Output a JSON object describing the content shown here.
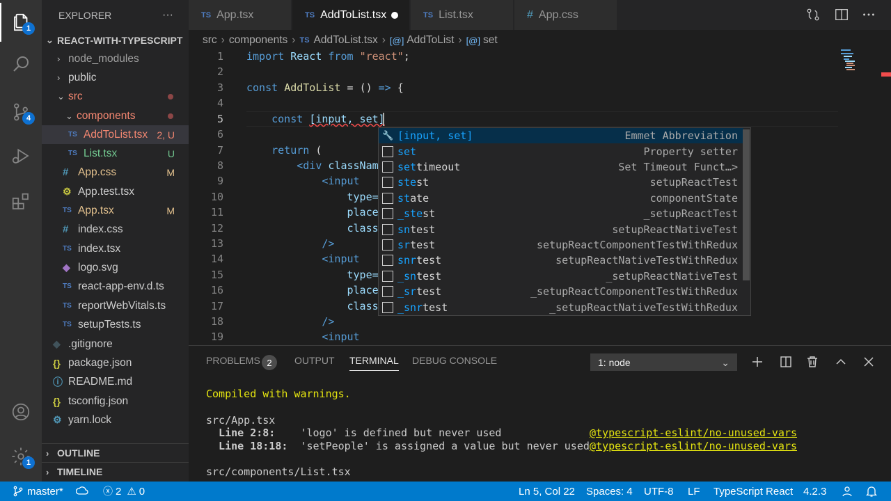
{
  "activity_bar": {
    "explorer_badge": "1",
    "scm_badge": "4",
    "settings_badge": "1"
  },
  "sidebar": {
    "title": "EXPLORER",
    "more": "···",
    "project": "REACT-WITH-TYPESCRIPT",
    "items": [
      {
        "label": "node_modules",
        "status": ""
      },
      {
        "label": "public",
        "status": ""
      },
      {
        "label": "src",
        "status": ""
      },
      {
        "label": "components",
        "status": ""
      },
      {
        "label": "AddToList.tsx",
        "status": "2, U"
      },
      {
        "label": "List.tsx",
        "status": "U"
      },
      {
        "label": "App.css",
        "status": "M"
      },
      {
        "label": "App.test.tsx",
        "status": ""
      },
      {
        "label": "App.tsx",
        "status": "M"
      },
      {
        "label": "index.css",
        "status": ""
      },
      {
        "label": "index.tsx",
        "status": ""
      },
      {
        "label": "logo.svg",
        "status": ""
      },
      {
        "label": "react-app-env.d.ts",
        "status": ""
      },
      {
        "label": "reportWebVitals.ts",
        "status": ""
      },
      {
        "label": "setupTests.ts",
        "status": ""
      },
      {
        "label": ".gitignore",
        "status": ""
      },
      {
        "label": "package.json",
        "status": ""
      },
      {
        "label": "README.md",
        "status": ""
      },
      {
        "label": "tsconfig.json",
        "status": ""
      },
      {
        "label": "yarn.lock",
        "status": ""
      }
    ],
    "file_badges": {
      "ts": "TS",
      "hash": "#",
      "braces": "{}",
      "info": "ⓘ",
      "gear": "⚙",
      "diamond": "◆"
    },
    "outline": "OUTLINE",
    "timeline": "TIMELINE"
  },
  "tabs": [
    {
      "label": "App.tsx",
      "type": "TS"
    },
    {
      "label": "AddToList.tsx",
      "type": "TS"
    },
    {
      "label": "List.tsx",
      "type": "TS"
    },
    {
      "label": "App.css",
      "type": "#"
    }
  ],
  "breadcrumb": {
    "parts": [
      "src",
      "components",
      "AddToList.tsx",
      "AddToList",
      "set"
    ],
    "ts_badge": "TS",
    "symbol": "[@]"
  },
  "editor": {
    "line_numbers": [
      "1",
      "2",
      "3",
      "4",
      "5",
      "6",
      "7",
      "8",
      "9",
      "10",
      "11",
      "12",
      "13",
      "14",
      "15",
      "16",
      "17",
      "18",
      "19"
    ],
    "l1": {
      "a": "import",
      "b": "React",
      "c": "from",
      "d": "\"react\"",
      "e": ";"
    },
    "l3": {
      "a": "const",
      "b": "AddToList",
      "c": "=",
      "d": "()",
      "e": "=>",
      "f": "{"
    },
    "l5": {
      "a": "const",
      "b": "[input, set]"
    },
    "l7": {
      "a": "return",
      "b": "("
    },
    "l8": {
      "a": "<div",
      "b": "classNam"
    },
    "l9": {
      "a": "<input"
    },
    "l10": {
      "a": "type="
    },
    "l11": {
      "a": "place"
    },
    "l12": {
      "a": "class"
    },
    "l13": {
      "a": "/>"
    },
    "l14": {
      "a": "<input"
    },
    "l15": {
      "a": "type="
    },
    "l16": {
      "a": "place"
    },
    "l17": {
      "a": "class"
    },
    "l18": {
      "a": "/>"
    },
    "l19": {
      "a": "<input"
    }
  },
  "suggestions": [
    {
      "match": "[input, set]",
      "rest": "",
      "detail": "Emmet Abbreviation",
      "selected": true
    },
    {
      "match": "set",
      "rest": "",
      "detail": "Property setter"
    },
    {
      "match": "set",
      "rest": "timeout",
      "detail": "Set Timeout Funct…>"
    },
    {
      "match": "ste",
      "rest": "st",
      "detail": "setupReactTest"
    },
    {
      "match": "st",
      "rest": "ate",
      "detail": "componentState"
    },
    {
      "match": "_ste",
      "rest": "st",
      "detail": "_setupReactTest"
    },
    {
      "match": "sn",
      "rest": "test",
      "detail": "setupReactNativeTest"
    },
    {
      "match": "sr",
      "rest": "test",
      "detail": "setupReactComponentTestWithRedux"
    },
    {
      "match": "snr",
      "rest": "test",
      "detail": "setupReactNativeTestWithRedux"
    },
    {
      "match": "_sn",
      "rest": "test",
      "detail": "_setupReactNativeTest"
    },
    {
      "match": "_sr",
      "rest": "test",
      "detail": "_setupReactComponentTestWithRedux"
    },
    {
      "match": "_snr",
      "rest": "test",
      "detail": "_setupReactNativeTestWithRedux"
    }
  ],
  "panel": {
    "tabs": [
      "PROBLEMS",
      "OUTPUT",
      "TERMINAL",
      "DEBUG CONSOLE"
    ],
    "problems_count": "2",
    "terminal_select": "1: node",
    "lines": {
      "compiled": "Compiled with warnings.",
      "file1": "src/App.tsx",
      "w1_loc": "  Line 2:8:",
      "w1_msg": "    'logo' is defined but never used",
      "w1_rule": "@typescript-eslint/no-unused-vars",
      "w2_loc": "  Line 18:18:",
      "w2_msg": "  'setPeople' is assigned a value but never used",
      "w2_rule": "@typescript-eslint/no-unused-vars",
      "file2": "src/components/List.tsx"
    }
  },
  "status_bar": {
    "branch": "master*",
    "errors": "2",
    "warnings": "0",
    "position": "Ln 5, Col 22",
    "spaces": "Spaces: 4",
    "encoding": "UTF-8",
    "eol": "LF",
    "language": "TypeScript React",
    "version": "4.2.3"
  },
  "colors": {
    "accent": "#007acc",
    "modified": "#e2c08d",
    "untracked": "#73c991",
    "error": "#f48771"
  }
}
